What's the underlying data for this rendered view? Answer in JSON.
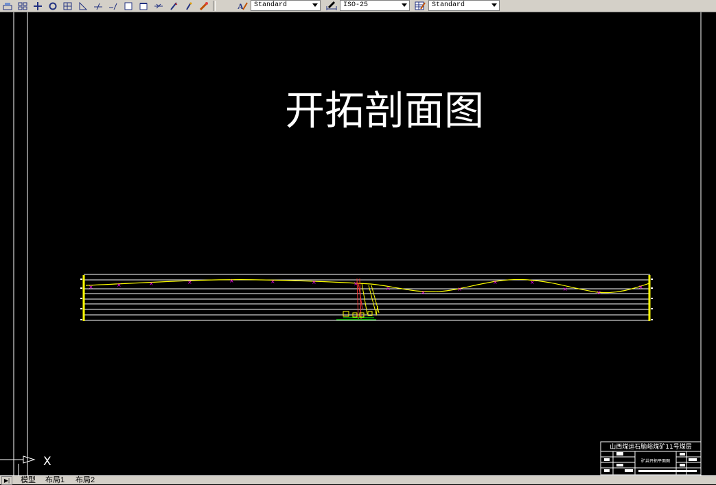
{
  "toolbar": {
    "icons": [
      "plot-icon",
      "viewports-icon",
      "pan-icon",
      "orbit-icon",
      "zoom-window-icon",
      "measure-icon",
      "line-icon",
      "polyline-icon",
      "rectangle-icon",
      "region-icon",
      "extend-icon",
      "pencil-icon",
      "edit-pencil-icon",
      "match-icon"
    ],
    "text_style": {
      "value": "Standard",
      "icon": "text-style-icon"
    },
    "dim_style": {
      "value": "ISO-25",
      "icon": "dim-style-icon"
    },
    "table_style": {
      "value": "Standard",
      "icon": "table-style-icon"
    }
  },
  "drawing": {
    "title": "开拓剖面图",
    "title_block": {
      "header": "山西煤运石脑峪煤矿11号煤层",
      "subtitle": "矿井开拓平面图"
    },
    "ucs_label": "X"
  },
  "tabs": {
    "items": [
      "模型",
      "布局1",
      "布局2"
    ]
  },
  "colors": {
    "background": "#000000",
    "line_white": "#ffffff",
    "line_yellow": "#ffff00",
    "marker_magenta": "#ff00ff",
    "shaft_red": "#ff3030",
    "ui_gray": "#d4d0c8"
  }
}
